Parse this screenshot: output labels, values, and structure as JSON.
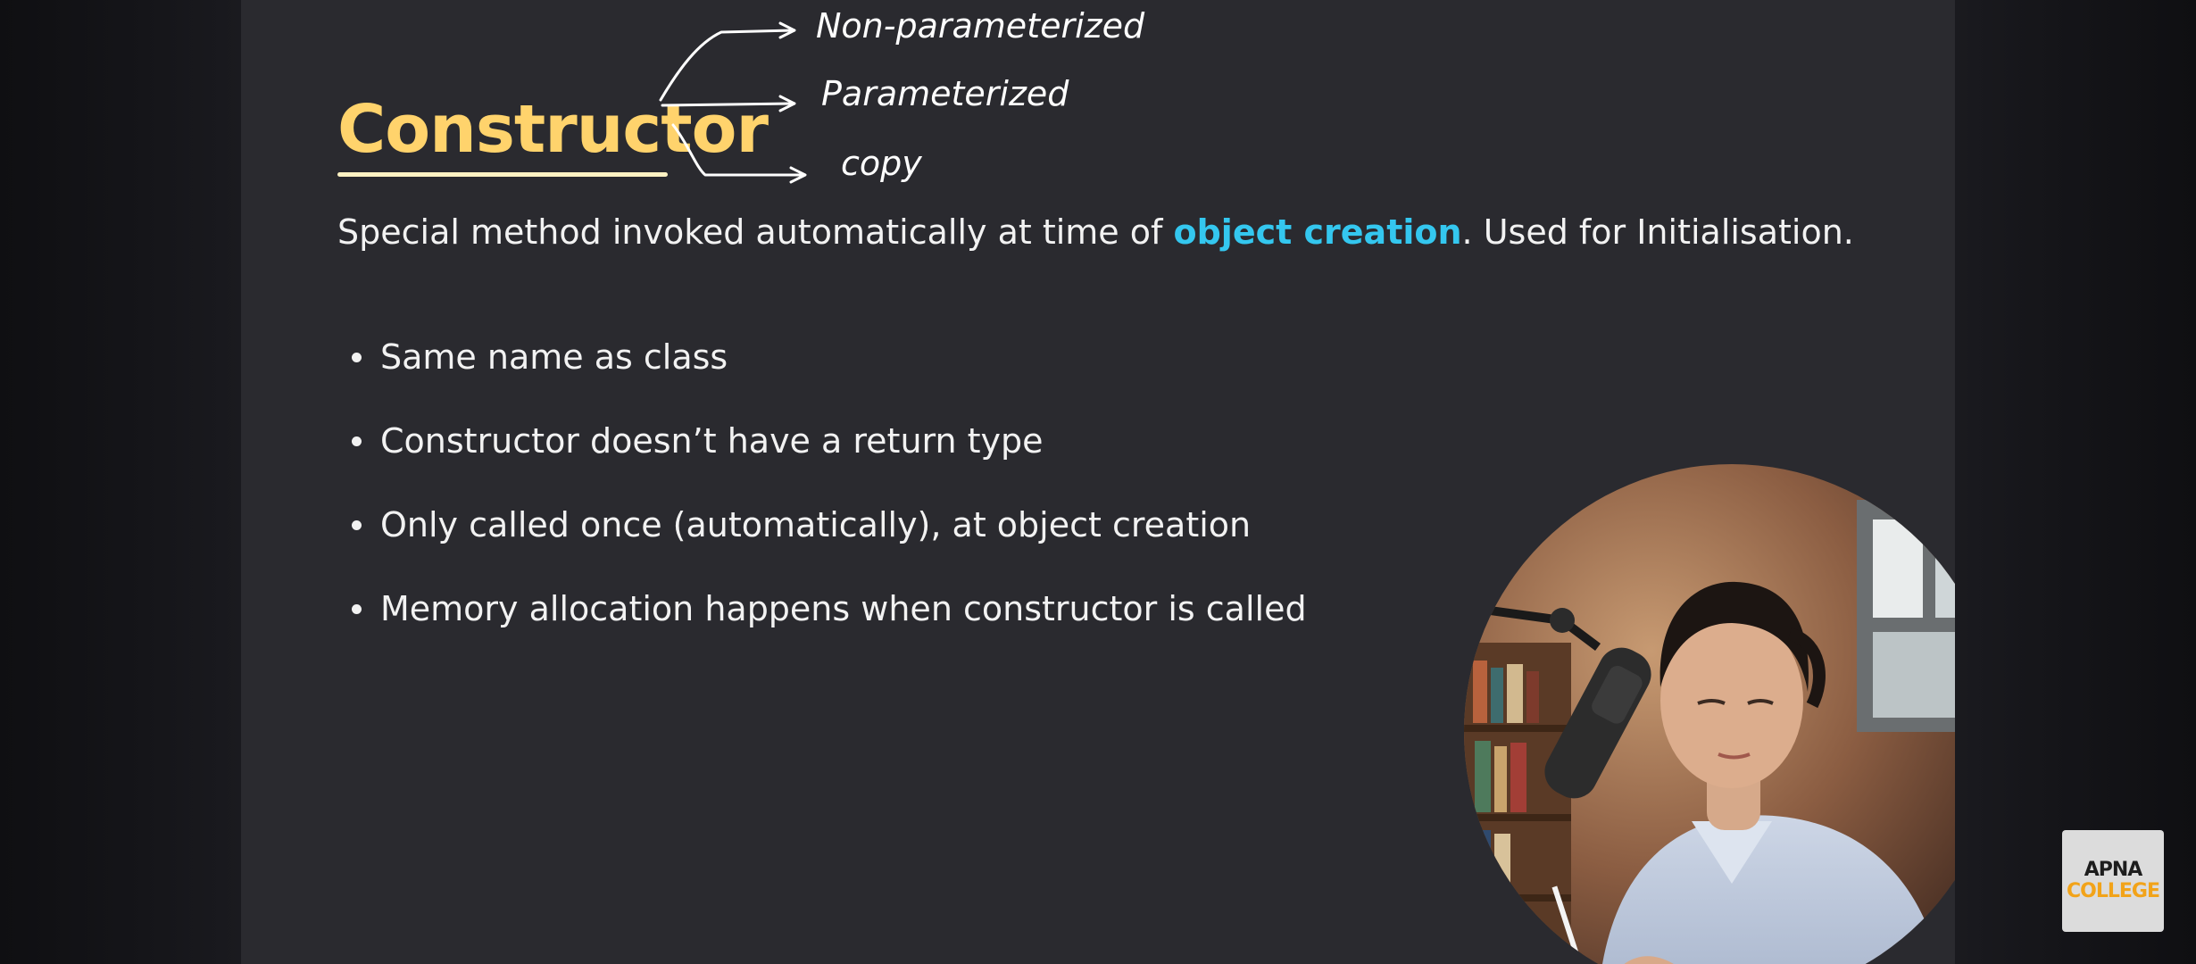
{
  "slide": {
    "title": "Constructor",
    "subtitle_parts": {
      "before": "Special method invoked automatically at time of ",
      "highlight": "object creation",
      "after": ". Used for Initialisation."
    },
    "bullets": [
      "Same name as class",
      "Constructor doesn’t have a return type",
      "Only called once (automatically), at object creation",
      "Memory allocation happens when constructor is called"
    ],
    "annotations": [
      "Non-parameterized",
      "Parameterized",
      "copy"
    ]
  },
  "logo": {
    "line1": "APNA",
    "line2": "COLLEGE"
  },
  "colors": {
    "title": "#ffd36c",
    "highlight": "#34c7ef",
    "slide_bg": "#2a2a2f",
    "logo_accent": "#f2a319"
  }
}
